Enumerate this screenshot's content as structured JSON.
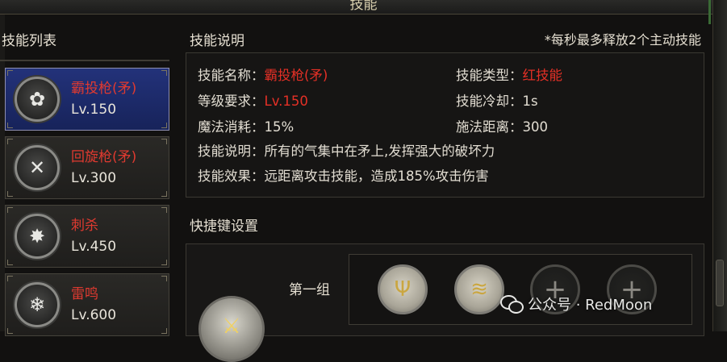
{
  "window": {
    "title": "技能"
  },
  "skill_list": {
    "title": "技能列表",
    "items": [
      {
        "name": "霸投枪(矛)",
        "level": "Lv.150",
        "icon": "knot-emblem-icon",
        "selected": true
      },
      {
        "name": "回旋枪(矛)",
        "level": "Lv.300",
        "icon": "crossed-spears-icon",
        "selected": false
      },
      {
        "name": "刺杀",
        "level": "Lv.450",
        "icon": "spike-burst-icon",
        "selected": false
      },
      {
        "name": "雷鸣",
        "level": "Lv.600",
        "icon": "thunder-icon",
        "selected": false
      }
    ]
  },
  "skill_info": {
    "title": "技能说明",
    "note": "*每秒最多释放2个主动技能",
    "name_label": "技能名称：",
    "name_value": "霸投枪(矛)",
    "type_label": "技能类型：",
    "type_value": "红技能",
    "req_label": "等级要求：",
    "req_value": "Lv.150",
    "cooldown_label": "技能冷却：",
    "cooldown_value": "1s",
    "mana_label": "魔法消耗：",
    "mana_value": "15%",
    "range_label": "施法距离：",
    "range_value": "300",
    "desc_label": "技能说明：",
    "desc_value": "所有的气集中在矛上,发挥强大的破坏力",
    "effect_label": "技能效果：",
    "effect_value": "远距离攻击技能，造成185%攻击伤害"
  },
  "hotkey": {
    "title": "快捷键设置",
    "group_label": "第一组",
    "slots": [
      {
        "state": "filled",
        "icon": "sword-skill-icon"
      },
      {
        "state": "filled",
        "icon": "wave-skill-icon"
      },
      {
        "state": "empty",
        "icon": "plus-icon"
      },
      {
        "state": "empty",
        "icon": "plus-icon"
      }
    ]
  },
  "watermark": {
    "text": "公众号 · RedMoon"
  },
  "colors": {
    "accent_red": "#e53026",
    "selected_bg": "#1e2c6e"
  }
}
